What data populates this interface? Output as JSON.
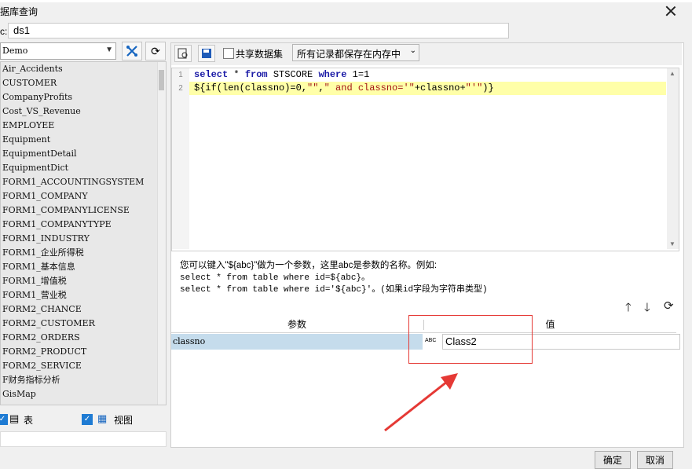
{
  "window": {
    "title": "据库查询"
  },
  "name_field": {
    "label": "c:",
    "value": "ds1"
  },
  "database_select": {
    "value": "Demo"
  },
  "tables": [
    "Air_Accidents",
    "CUSTOMER",
    "CompanyProfits",
    "Cost_VS_Revenue",
    "EMPLOYEE",
    "Equipment",
    "EquipmentDetail",
    "EquipmentDict",
    "FORM1_ACCOUNTINGSYSTEM",
    "FORM1_COMPANY",
    "FORM1_COMPANYLICENSE",
    "FORM1_COMPANYTYPE",
    "FORM1_INDUSTRY",
    "FORM1_企业所得税",
    "FORM1_基本信息",
    "FORM1_增值税",
    "FORM1_营业税",
    "FORM2_CHANCE",
    "FORM2_CUSTOMER",
    "FORM2_ORDERS",
    "FORM2_PRODUCT",
    "FORM2_SERVICE",
    "F财务指标分析",
    "GisMap"
  ],
  "bottom_left": {
    "table_label": "表",
    "view_label": "视图",
    "table_checked": true,
    "view_checked": true
  },
  "toolbar": {
    "shared_dataset_label": "共享数据集",
    "storage_option": "所有记录都保存在内存中"
  },
  "editor": {
    "line_numbers": [
      "1",
      "2"
    ],
    "line1": {
      "kw1": "select",
      "star": " * ",
      "kw2": "from",
      "table": " STSCORE ",
      "kw3": "where",
      "cond": " 1=1"
    },
    "line2": {
      "p1": "${if(len(classno)=0,",
      "s1": "\"\"",
      "p2": ",",
      "s2": "\" and classno='\"",
      "p3": "+classno+",
      "s3": "\"'\"",
      "p4": ")}"
    }
  },
  "hints": {
    "line1": "您可以键入\"${abc}\"做为一个参数，这里abc是参数的名称。例如:",
    "line2": "select * from table where id=${abc}。",
    "line3": "select * from table where id='${abc}'。(如果id字段为字符串类型)"
  },
  "param_grid": {
    "headers": [
      "参数",
      "值"
    ],
    "rows": [
      {
        "name": "classno",
        "type_icon_text": "ABC",
        "value": "Class2"
      }
    ]
  },
  "buttons": {
    "ok": "确定",
    "cancel": "取消"
  },
  "colors": {
    "highlight_line": "#ffffa8",
    "selected_row": "#c5dcec",
    "annotation": "#e53935"
  }
}
